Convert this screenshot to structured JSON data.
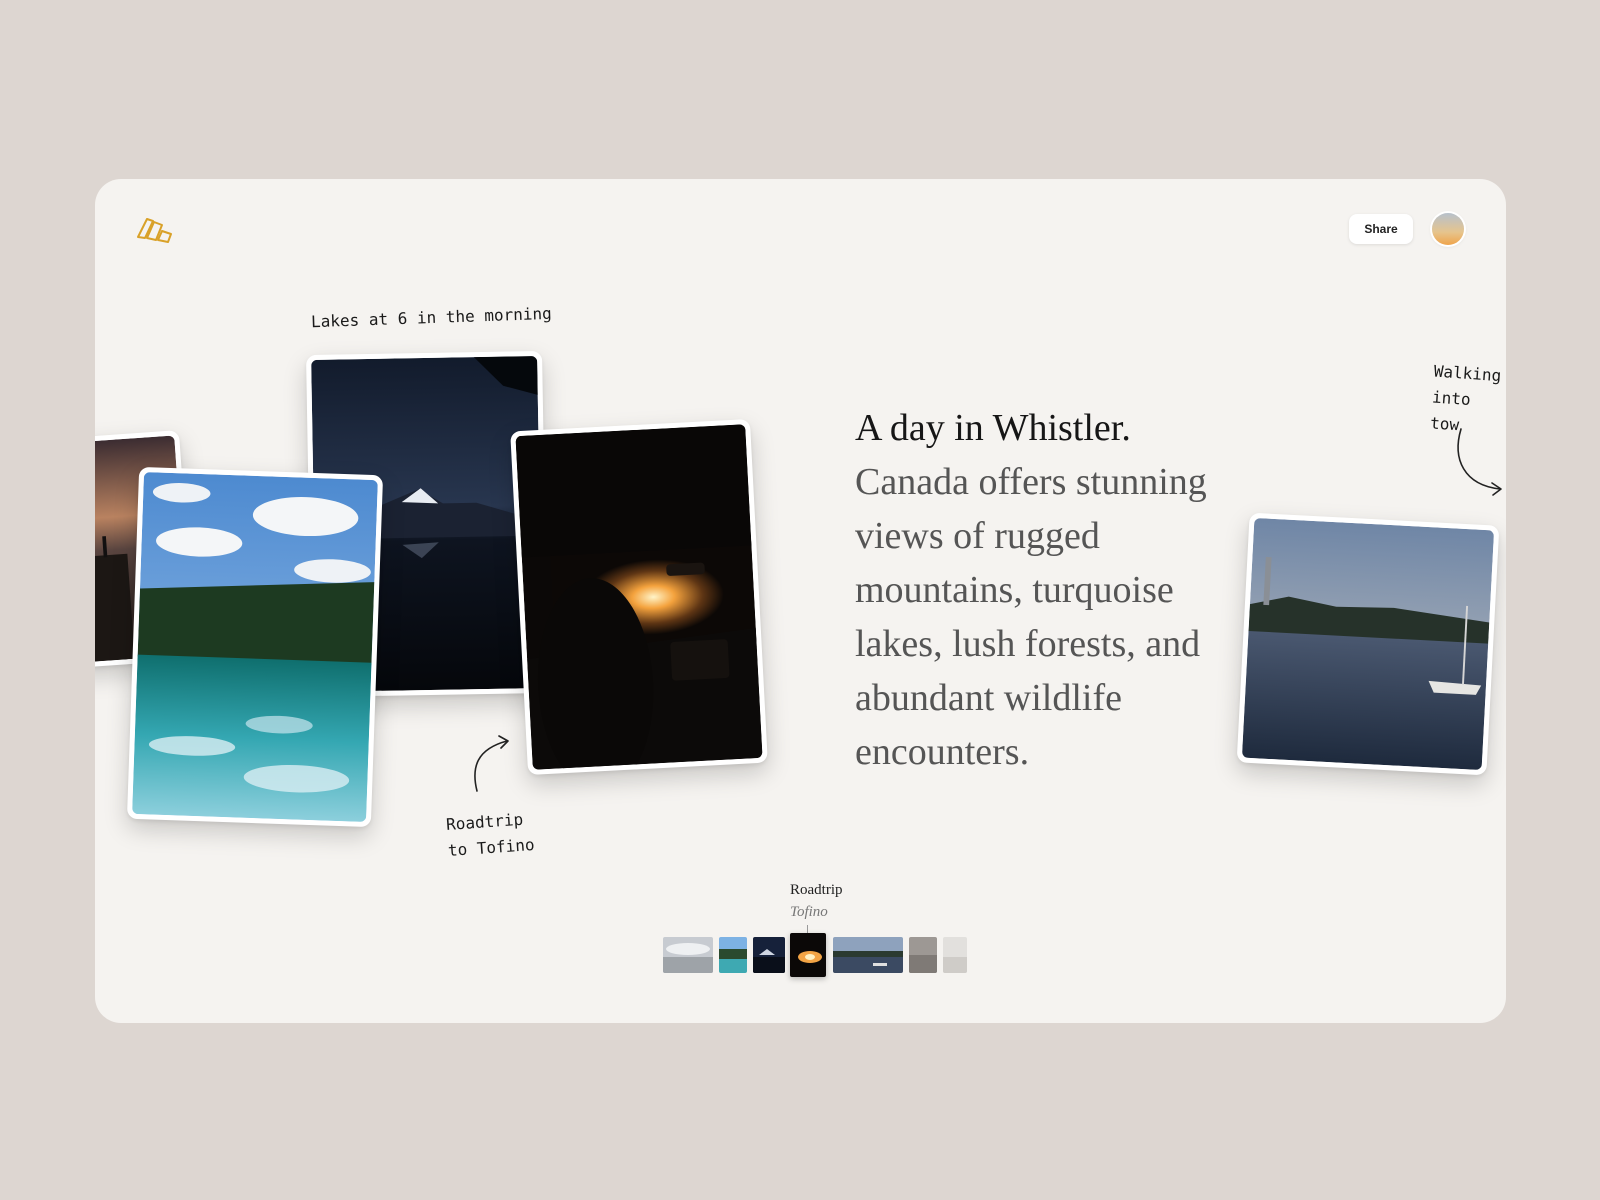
{
  "header": {
    "share_label": "Share",
    "logo_icon": "stacked-photos-logo-icon",
    "avatar": "user-avatar",
    "accent_color": "#d9a128"
  },
  "notes": {
    "lakes_morning": "Lakes at 6 in the morning",
    "roadtrip": "Roadtrip\nto Tofino",
    "walking": "Walking\ninto tow"
  },
  "story": {
    "title": "A day in Whistler.",
    "body": "Canada offers stunning views of rugged mountains, turquoise lakes, lush forests, and abundant wildlife encounters."
  },
  "timeline": {
    "current_title": "Roadtrip",
    "current_subtitle": "Tofino",
    "thumbnails": [
      "clouds",
      "turquoise-lake",
      "mountain-lake",
      "car-sunset",
      "harbor",
      "gray",
      "light"
    ],
    "active_index": 3
  },
  "photos": [
    "sunset-cliff",
    "turquoise-lake-forest",
    "mountain-lake-dusk",
    "car-sunset",
    "harbor-boats"
  ]
}
